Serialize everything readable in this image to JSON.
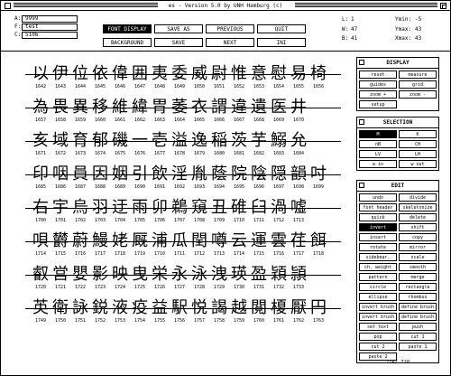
{
  "window": {
    "title": "es  -  Version 5.0  by UNH Hamburg (c)"
  },
  "info": [
    {
      "key": "A:",
      "value": "9999"
    },
    {
      "key": "F:",
      "value": "test"
    },
    {
      "key": "C:",
      "value": "5106"
    }
  ],
  "toolbar": {
    "row1": [
      {
        "label": "FONT DISPLAY",
        "selected": true
      },
      {
        "label": "SAVE AS",
        "selected": false
      },
      {
        "label": "PREVIOUS",
        "selected": false
      },
      {
        "label": "QUIT",
        "selected": false
      }
    ],
    "row2": [
      {
        "label": "BACKGROUND",
        "selected": false
      },
      {
        "label": "SAVE",
        "selected": false
      },
      {
        "label": "NEXT",
        "selected": false
      },
      {
        "label": "INI",
        "selected": false
      }
    ]
  },
  "stats_left": [
    {
      "key": "L:",
      "value": "1"
    },
    {
      "key": "W:",
      "value": "47"
    },
    {
      "key": "B:",
      "value": "41"
    }
  ],
  "stats_right": [
    {
      "key": "Ymin:",
      "value": "-5"
    },
    {
      "key": "Ymax:",
      "value": "43"
    },
    {
      "key": "Xmax:",
      "value": "43"
    }
  ],
  "rows": [
    {
      "chars": "以伊位依偉囲夷委威尉惟意慰易椅",
      "codes": [
        "1642",
        "1643",
        "1644",
        "1645",
        "1646",
        "1647",
        "1648",
        "1649",
        "1650",
        "1651",
        "1652",
        "1653",
        "1654",
        "1655",
        "1656"
      ]
    },
    {
      "chars": "為畏異移維緯胃萎衣謂違遺医井",
      "codes": [
        "1657",
        "1658",
        "1659",
        "1660",
        "1661",
        "1662",
        "1663",
        "1664",
        "1665",
        "1666",
        "1667",
        "1668",
        "1669",
        "1670"
      ]
    },
    {
      "chars": "亥域育郁磯一壱溢逸稲茨芋鰯允",
      "codes": [
        "1671",
        "1672",
        "1673",
        "1674",
        "1675",
        "1676",
        "1677",
        "1678",
        "1679",
        "1680",
        "1681",
        "1682",
        "1683",
        "1684"
      ]
    },
    {
      "chars": "印咽員因姻引飲淫胤蔭院陰隠韻吋",
      "codes": [
        "1685",
        "1686",
        "1687",
        "1688",
        "1689",
        "1690",
        "1691",
        "1692",
        "1693",
        "1694",
        "1695",
        "1696",
        "1697",
        "1698",
        "1699"
      ]
    },
    {
      "chars": "右宇烏羽迂雨卯鵜窺丑碓臼渦嘘",
      "codes": [
        "1700",
        "1701",
        "1702",
        "1703",
        "1704",
        "1705",
        "1706",
        "1707",
        "1708",
        "1709",
        "1710",
        "1711",
        "1712",
        "1713"
      ]
    },
    {
      "chars": "唄欝蔚鰻姥厩浦瓜閏噂云運雲荏餌",
      "codes": [
        "1714",
        "1715",
        "1716",
        "1717",
        "1718",
        "1719",
        "1710",
        "1711",
        "1712",
        "1713",
        "1714",
        "1715",
        "1716",
        "1717",
        "1718"
      ]
    },
    {
      "chars": "叡営嬰影映曳栄永泳洩瑛盈穎頴",
      "codes": [
        "1720",
        "1721",
        "1722",
        "1723",
        "1724",
        "1725",
        "1726",
        "1727",
        "1728",
        "1729",
        "1730",
        "1731",
        "1732",
        "1733"
      ]
    },
    {
      "chars": "英衛詠鋭液疫益駅悦謁越閲榎厭円",
      "codes": [
        "1749",
        "1750",
        "1751",
        "1752",
        "1753",
        "1754",
        "1755",
        "1756",
        "1757",
        "1758",
        "1759",
        "1760",
        "1761",
        "1762",
        "1763"
      ]
    }
  ],
  "display_panel": {
    "title": "DISPLAY",
    "buttons": [
      {
        "label": "reset",
        "selected": false
      },
      {
        "label": "measure",
        "selected": false
      },
      {
        "label": "guides",
        "selected": false
      },
      {
        "label": "grid",
        "selected": false
      },
      {
        "label": "zoom +",
        "selected": false
      },
      {
        "label": "zoom -",
        "selected": false
      },
      {
        "label": "setup",
        "selected": false
      }
    ]
  },
  "selection_panel": {
    "title": "SELECTION",
    "buttons": [
      {
        "label": "M",
        "selected": true
      },
      {
        "label": "K",
        "selected": false
      },
      {
        "label": "nB",
        "selected": false
      },
      {
        "label": "CH",
        "selected": false
      },
      {
        "label": "LV",
        "selected": false
      },
      {
        "label": "LH",
        "selected": false
      },
      {
        "label": "w in",
        "selected": false
      },
      {
        "label": "w out",
        "selected": false
      }
    ]
  },
  "edit_panel": {
    "title": "EDIT",
    "buttons": [
      {
        "label": "undo",
        "selected": false,
        "full": false
      },
      {
        "label": "divide",
        "selected": false,
        "full": false
      },
      {
        "label": "font header",
        "selected": false,
        "full": false
      },
      {
        "label": "skeletonize",
        "selected": false,
        "full": false
      },
      {
        "label": "quick",
        "selected": false,
        "full": false
      },
      {
        "label": "delete",
        "selected": false,
        "full": false
      },
      {
        "label": "invert",
        "selected": true,
        "full": false
      },
      {
        "label": "shift",
        "selected": false,
        "full": false
      },
      {
        "label": "insert",
        "selected": false,
        "full": false
      },
      {
        "label": "copy",
        "selected": false,
        "full": false
      },
      {
        "label": "rotate",
        "selected": false,
        "full": false
      },
      {
        "label": "mirror",
        "selected": false,
        "full": false
      },
      {
        "label": "sidebear.",
        "selected": false,
        "full": false
      },
      {
        "label": "scale",
        "selected": false,
        "full": false
      },
      {
        "label": "ch. weight",
        "selected": false,
        "full": false
      },
      {
        "label": "smooth",
        "selected": false,
        "full": false
      },
      {
        "label": "pattern",
        "selected": false,
        "full": false
      },
      {
        "label": "merge",
        "selected": false,
        "full": false
      },
      {
        "label": "circle",
        "selected": false,
        "full": false
      },
      {
        "label": "rectangle",
        "selected": false,
        "full": false
      },
      {
        "label": "ellipse",
        "selected": false,
        "full": false
      },
      {
        "label": "rhombus",
        "selected": false,
        "full": false
      },
      {
        "label": "invert brush",
        "selected": false,
        "full": false
      },
      {
        "label": "define brush",
        "selected": false,
        "full": false
      },
      {
        "label": "invert brush",
        "selected": false,
        "full": false
      },
      {
        "label": "define brush",
        "selected": false,
        "full": false
      },
      {
        "label": "set text",
        "selected": false,
        "full": false
      },
      {
        "label": "push",
        "selected": false,
        "full": false
      },
      {
        "label": "pop",
        "selected": false,
        "full": false
      },
      {
        "label": "cut 1",
        "selected": false,
        "full": false
      },
      {
        "label": "cut 2",
        "selected": false,
        "full": false
      },
      {
        "label": "paste 1",
        "selected": false,
        "full": false
      },
      {
        "label": "paste 2",
        "selected": false,
        "full": false
      }
    ]
  },
  "counter": "274/  720"
}
